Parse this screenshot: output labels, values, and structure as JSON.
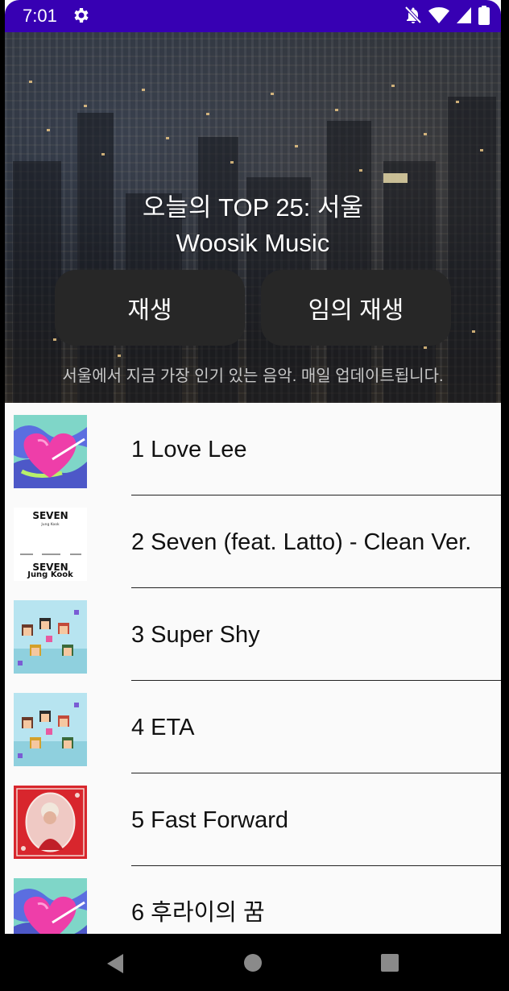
{
  "status_bar": {
    "time": "7:01"
  },
  "header": {
    "title_line1": "오늘의 TOP 25: 서울",
    "title_line2": "Woosik Music",
    "play_label": "재생",
    "shuffle_label": "임의 재생",
    "description": "서울에서 지금 가장 인기 있는 음악. 매일 업데이트됩니다."
  },
  "tracks": [
    {
      "label": "1 Love Lee",
      "art": "heart"
    },
    {
      "label": "2 Seven (feat. Latto) - Clean Ver.",
      "art": "seven"
    },
    {
      "label": "3 Super Shy",
      "art": "pixel"
    },
    {
      "label": "4 ETA",
      "art": "pixel"
    },
    {
      "label": "5 Fast Forward",
      "art": "portrait"
    },
    {
      "label": "6 후라이의 꿈",
      "art": "heart"
    }
  ],
  "colors": {
    "status_bar": "#3700b3",
    "button_bg": "#272727",
    "list_bg": "#fafafa"
  },
  "art_text": {
    "seven_title": "SEVEN",
    "seven_artist": "Jung Kook"
  }
}
